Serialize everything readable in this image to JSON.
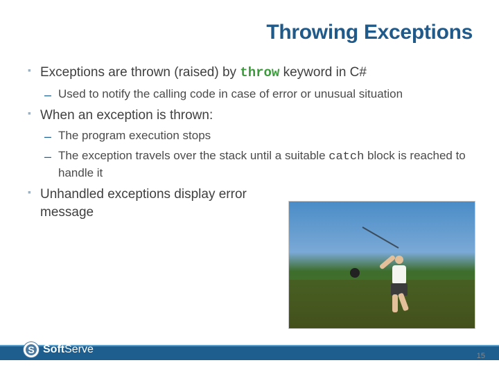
{
  "title": "Throwing Exceptions",
  "bullets": {
    "b1": "Exceptions are thrown (raised) by ",
    "b1_kw": "throw",
    "b1_tail": " keyword in C#",
    "b1_sub1": "Used to notify the calling code in case of error or unusual situation",
    "b2": "When an exception is thrown:",
    "b2_sub1": "The program execution stops",
    "b2_sub2a": "The exception travels over the stack until a suitable ",
    "b2_sub2_kw": "catch",
    "b2_sub2b": " block is reached to handle it",
    "b3": "Unhandled exceptions display error message"
  },
  "logo": {
    "mark": "S",
    "name_bold": "Soft",
    "name_rest": "Serve"
  },
  "page_number": "15"
}
